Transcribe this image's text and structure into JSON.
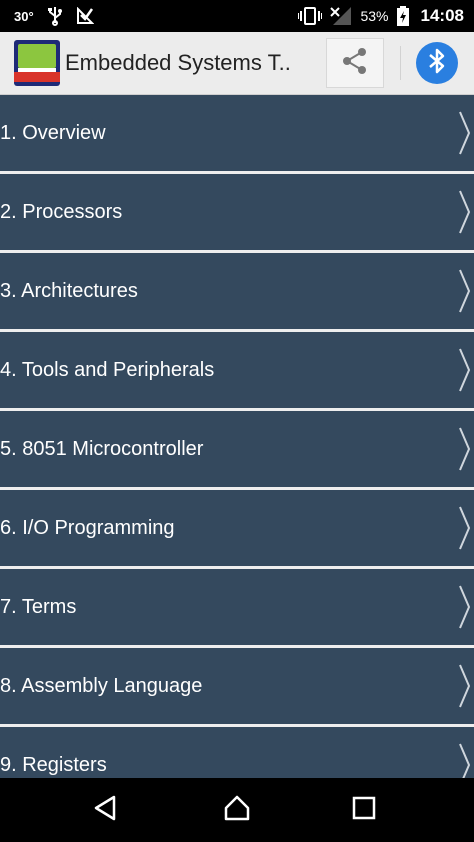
{
  "status_bar": {
    "temperature": "30°",
    "battery_percent": "53%",
    "time": "14:08"
  },
  "app_bar": {
    "title": "Embedded Systems T..",
    "logo_icon": "embedded-systems-tutorial-logo",
    "share_icon": "share-icon",
    "bluetooth_icon": "bluetooth-icon"
  },
  "menu": {
    "items": [
      {
        "label": "1. Overview"
      },
      {
        "label": "2. Processors"
      },
      {
        "label": "3. Architectures"
      },
      {
        "label": "4. Tools and Peripherals"
      },
      {
        "label": "5. 8051 Microcontroller"
      },
      {
        "label": "6. I/O Programming"
      },
      {
        "label": "7. Terms"
      },
      {
        "label": "8. Assembly Language"
      },
      {
        "label": "9. Registers"
      }
    ]
  },
  "colors": {
    "list_item_bg": "#34495e",
    "app_bar_bg": "#ececec",
    "bluetooth_blue": "#2a7fe0"
  }
}
